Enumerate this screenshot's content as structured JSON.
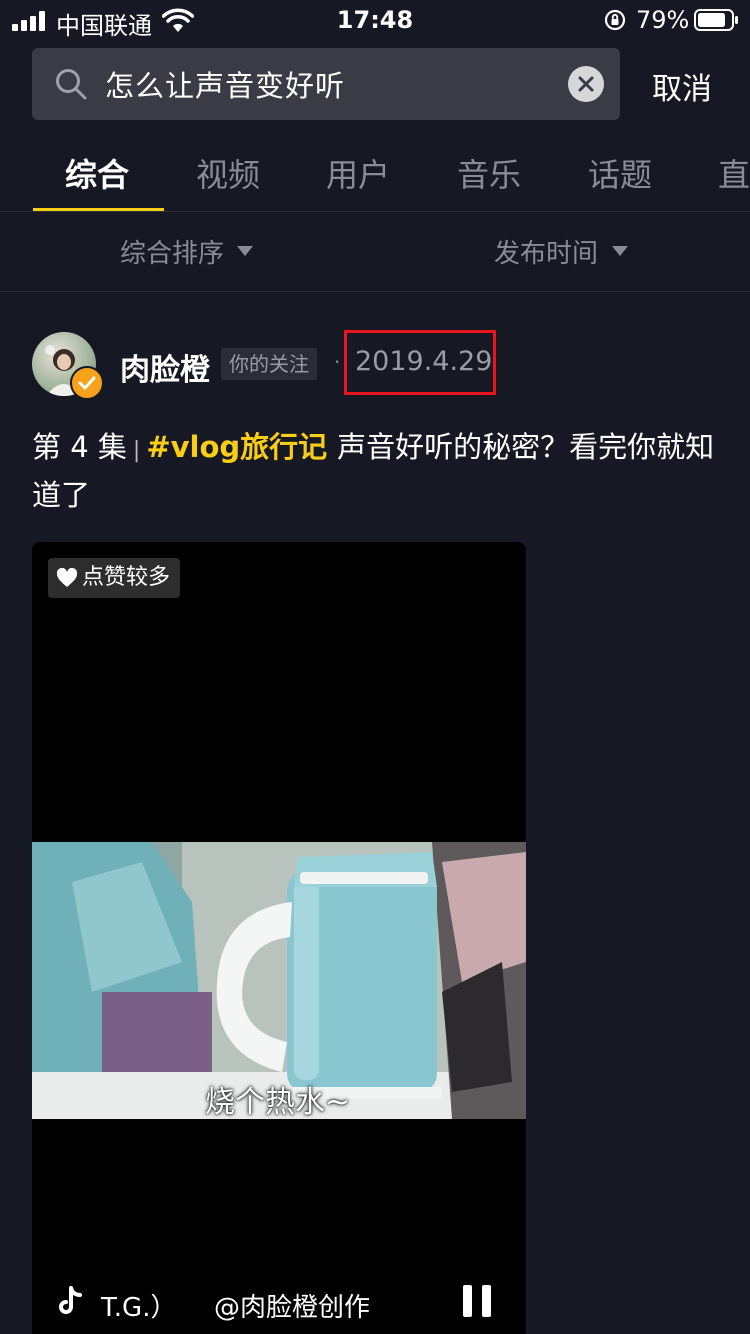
{
  "status_bar": {
    "carrier": "中国联通",
    "time": "17:48",
    "battery_percent": "79%"
  },
  "search": {
    "query": "怎么让声音变好听",
    "cancel_label": "取消"
  },
  "tabs": [
    {
      "label": "综合",
      "active": true
    },
    {
      "label": "视频"
    },
    {
      "label": "用户"
    },
    {
      "label": "音乐"
    },
    {
      "label": "话题"
    },
    {
      "label": "直"
    }
  ],
  "filters": {
    "sort_label": "综合排序",
    "time_label": "发布时间"
  },
  "post": {
    "author": "肉脸橙",
    "follow_badge": "你的关注",
    "separator": "·",
    "date": "2019.4.29",
    "caption": {
      "episode": "第 4 集",
      "divider": "|",
      "hashtag": "#vlog旅行记",
      "text": "声音好听的秘密？看完你就知道了"
    },
    "video": {
      "likes_badge": "点赞较多",
      "subtitle": "烧个热水~",
      "music_text": "T.G.）",
      "author_handle": "@肉脸橙创作"
    }
  },
  "colors": {
    "background": "#161823",
    "accent": "#face15",
    "highlight_box": "#e8141e"
  }
}
